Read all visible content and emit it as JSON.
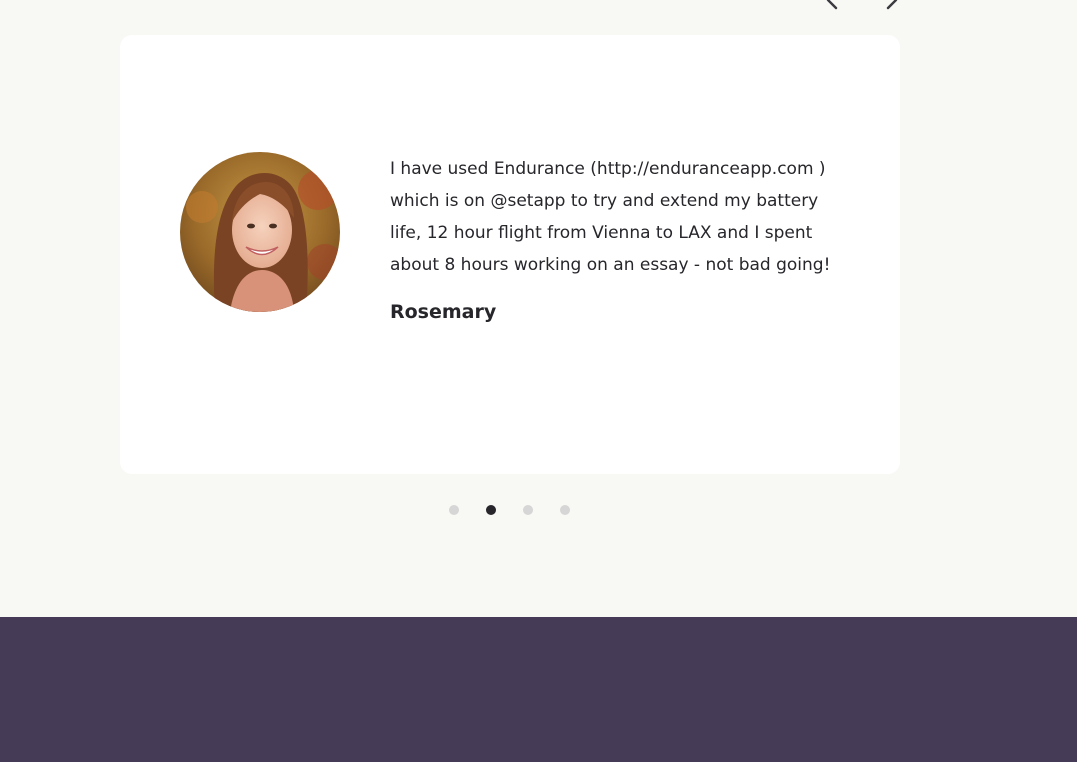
{
  "carousel": {
    "prev_icon": "chevron-left-icon",
    "next_icon": "chevron-right-icon",
    "arrow_color": "#3a3a3f",
    "slide_count": 4,
    "active_slide": 2
  },
  "testimonial": {
    "quote": "I have used Endurance (http://enduranceapp.com ) which is on @setapp to try and extend my battery life, 12 hour flight from Vienna to LAX and I spent about 8 hours working on an essay - not bad going!",
    "author": "Rosemary"
  },
  "colors": {
    "page_background": "#f8f8f5",
    "card_background": "#ffffff",
    "text": "#26262b",
    "dot_active": "#26262b",
    "dot_inactive": "#d6d6d6",
    "cta_background": "#453b56"
  }
}
